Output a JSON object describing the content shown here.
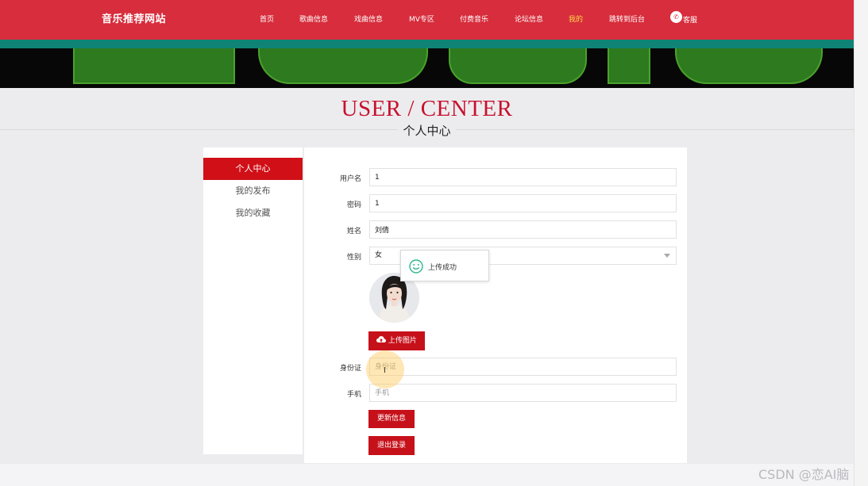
{
  "header": {
    "brand": "音乐推荐网站",
    "nav": [
      "首页",
      "歌曲信息",
      "戏曲信息",
      "MV专区",
      "付费音乐",
      "论坛信息",
      "我的",
      "跳转到后台",
      "客服"
    ],
    "active_index": 6,
    "service_icon": "wechat-icon",
    "colors": {
      "primary": "#d72d3c",
      "teal": "#0f8476",
      "active": "#ffd84a"
    }
  },
  "heading": {
    "en": "USER / CENTER",
    "cn": "个人中心"
  },
  "sidebar": {
    "items": [
      "个人中心",
      "我的发布",
      "我的收藏"
    ],
    "active_index": 0
  },
  "form": {
    "username": {
      "label": "用户名",
      "value": "1"
    },
    "password": {
      "label": "密码",
      "value": "1"
    },
    "name": {
      "label": "姓名",
      "value": "刘倩"
    },
    "gender": {
      "label": "性别",
      "value": "女"
    },
    "upload_button": "上传图片",
    "id_card": {
      "label": "身份证",
      "placeholder": "身份证"
    },
    "phone": {
      "label": "手机",
      "placeholder": "手机"
    },
    "update_button": "更新信息",
    "logout_button": "退出登录"
  },
  "toast": {
    "text": "上传成功",
    "icon": "smile-icon"
  },
  "watermark": "CSDN @恋AI脑"
}
